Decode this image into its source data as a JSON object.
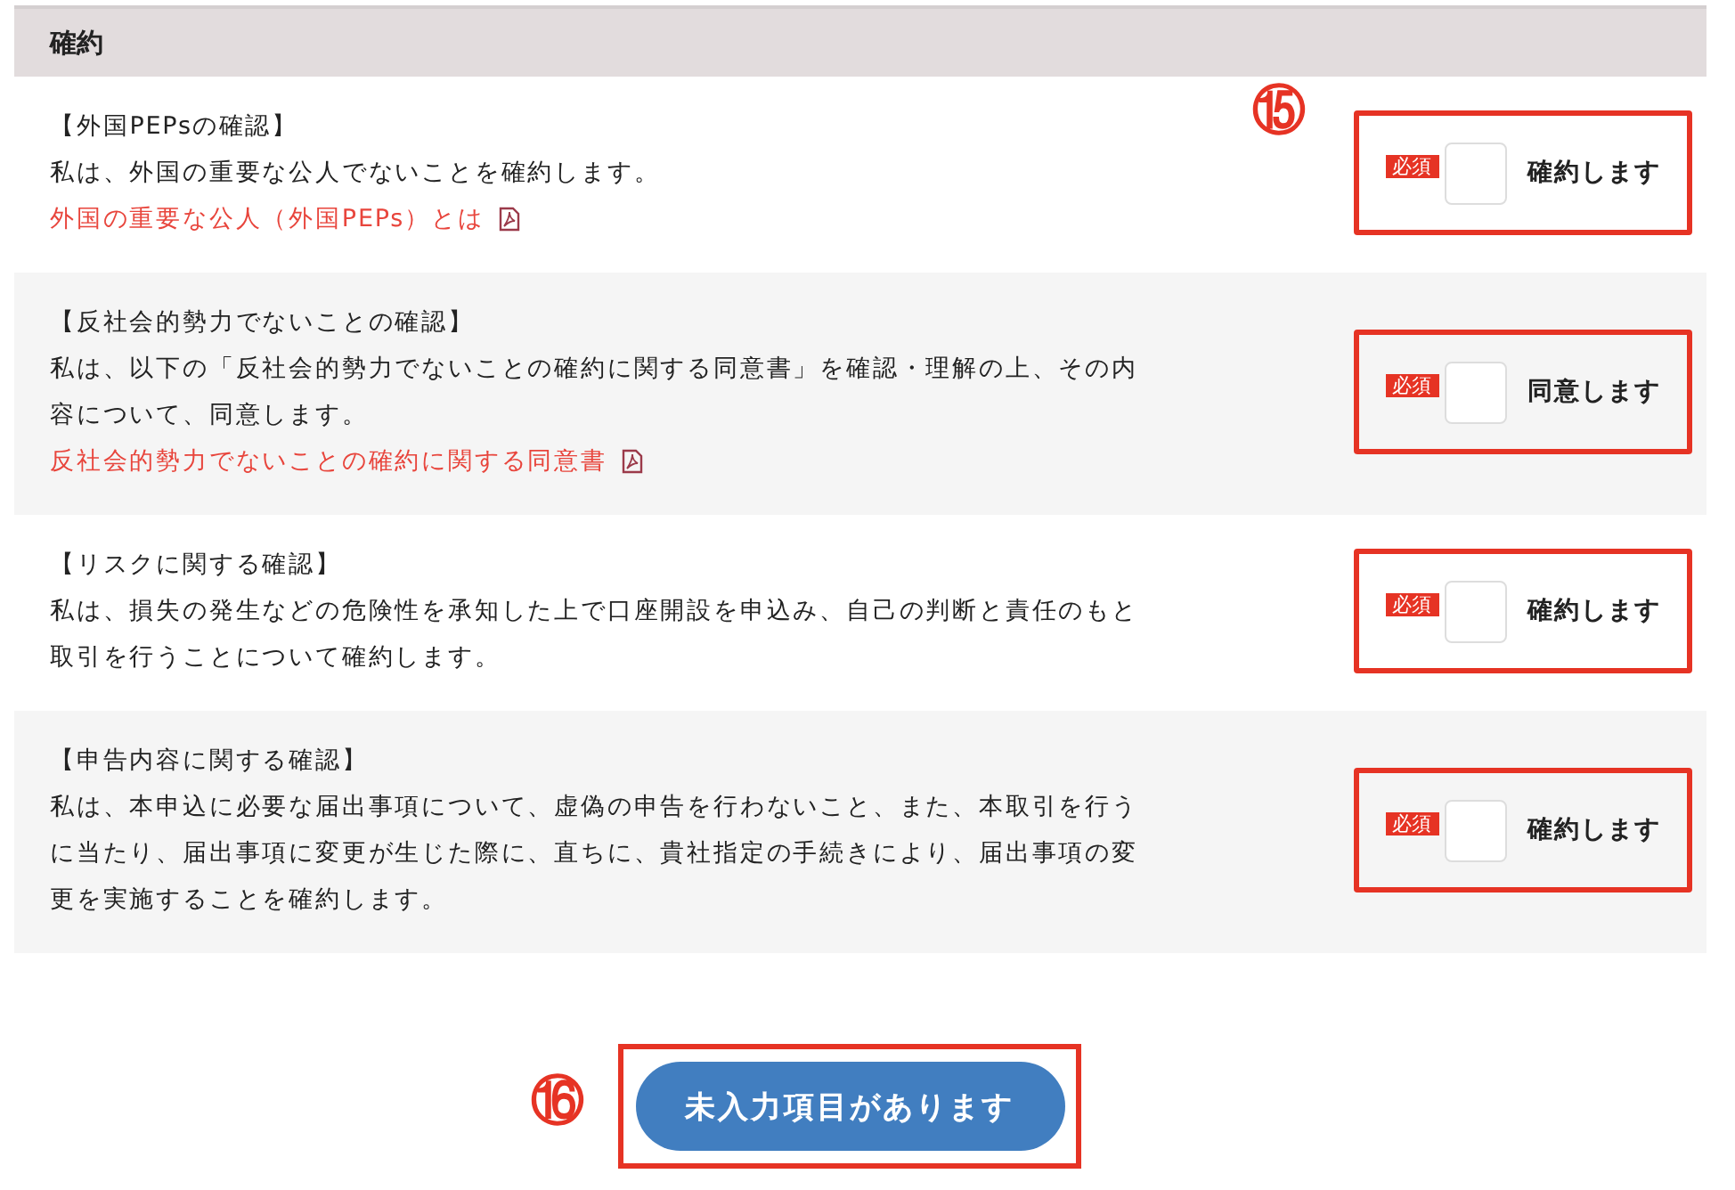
{
  "section": {
    "title": "確約"
  },
  "items": [
    {
      "title": "【外国PEPsの確認】",
      "body": "私は、外国の重要な公人でないことを確約します。",
      "link": "外国の重要な公人（外国PEPs）とは",
      "required": "必須",
      "checked": false,
      "label": "確約します",
      "highlighted": true,
      "annotation": "⑮"
    },
    {
      "title": "【反社会的勢力でないことの確認】",
      "body": "私は、以下の「反社会的勢力でないことの確約に関する同意書」を確認・理解の上、その内容について、同意します。",
      "link": "反社会的勢力でないことの確約に関する同意書",
      "required": "必須",
      "checked": false,
      "label": "同意します",
      "highlighted": true
    },
    {
      "title": "【リスクに関する確認】",
      "body": "私は、損失の発生などの危険性を承知した上で口座開設を申込み、自己の判断と責任のもと取引を行うことについて確約します。",
      "required": "必須",
      "checked": false,
      "label": "確約します",
      "highlighted": true
    },
    {
      "title": "【申告内容に関する確認】",
      "body": "私は、本申込に必要な届出事項について、虚偽の申告を行わないこと、また、本取引を行うに当たり、届出事項に変更が生じた際に、直ちに、貴社指定の手続きにより、届出事項の変更を実施することを確約します。",
      "required": "必須",
      "checked": false,
      "label": "確約します",
      "highlighted": true
    }
  ],
  "submit": {
    "label": "未入力項目があります",
    "disabled": true,
    "highlighted": true,
    "annotation": "⑯"
  }
}
